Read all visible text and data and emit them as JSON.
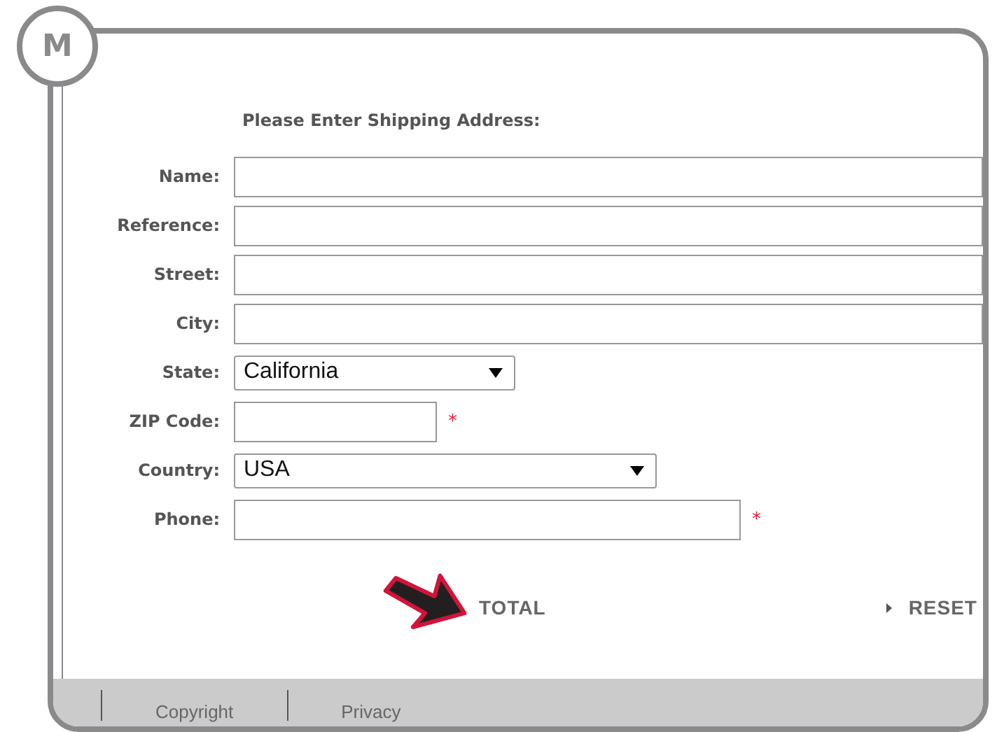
{
  "badge": "M",
  "heading": "Please Enter Shipping Address:",
  "fields": [
    {
      "label": "Name:",
      "kind": "text",
      "required": false
    },
    {
      "label": "Reference:",
      "kind": "text",
      "required": false
    },
    {
      "label": "Street:",
      "kind": "text",
      "required": false
    },
    {
      "label": "City:",
      "kind": "text",
      "required": false
    },
    {
      "label": "State:",
      "kind": "select",
      "value": "California",
      "required": false
    },
    {
      "label": "ZIP Code:",
      "kind": "short-text",
      "required": true
    },
    {
      "label": "Country:",
      "kind": "wide-select",
      "value": "USA",
      "required": false
    },
    {
      "label": "Phone:",
      "kind": "long-text",
      "required": true
    }
  ],
  "required_mark": "*",
  "actions": {
    "total": "TOTAL",
    "reset": "RESET"
  },
  "footer_links": [
    "Copyright",
    "Privacy"
  ]
}
